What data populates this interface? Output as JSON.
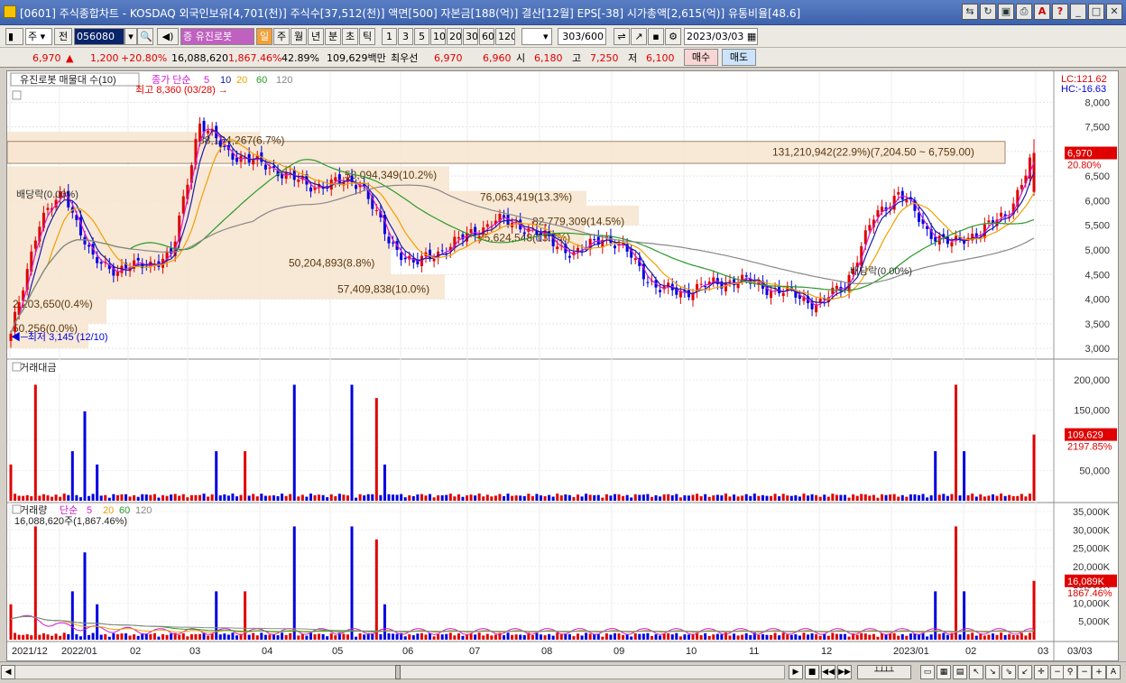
{
  "window": {
    "title": "[0601] 주식종합차트 - KOSDAQ 외국인보유[4,701(천)] 주식수[37,512(천)] 액면[500] 자본금[188(억)] 결산[12월] EPS[-38] 시가총액[2,615(억)] 유통비율[48.6]"
  },
  "toolbar": {
    "period_select": "주",
    "prev_label": "전",
    "stock_code": "056080",
    "stock_name": "유진로봇",
    "tabs": [
      "일",
      "주",
      "월",
      "년",
      "분",
      "초",
      "틱"
    ],
    "active_tab": "일",
    "intervals": [
      "1",
      "3",
      "5",
      "10",
      "20",
      "30",
      "60",
      "120"
    ],
    "count": "303",
    "count_total": "/600",
    "date": "2023/03/03"
  },
  "quote": {
    "price": "6,970",
    "arrow": "▲",
    "change": "1,200",
    "change_pct": "+20.80%",
    "volume": "16,088,620",
    "volume_pct": "1,867.46%",
    "ratio": "42.89%",
    "amount": "109,629백만",
    "best_label": "최우선",
    "best_ask": "6,970",
    "best_bid": "6,960",
    "open_label": "시",
    "open": "6,180",
    "high_label": "고",
    "high": "7,250",
    "low_label": "저",
    "low": "6,100",
    "buy_label": "매수",
    "sell_label": "매도"
  },
  "price_panel": {
    "legend_stock": "유진로봇 매물대 수(10)",
    "legend_ma": "종가 단순",
    "ma_periods": [
      "5",
      "10",
      "20",
      "60",
      "120"
    ],
    "high_label": "최고 8,360 (03/28)",
    "low_label": "최저 3,145 (12/10)",
    "lc": "LC:121.62",
    "hc": "HC:-16.63",
    "last_price": "6,970",
    "last_pct": "20.80%",
    "dividend_labels": [
      "배당락(0.00%)",
      "배당락(0.00%)"
    ],
    "volume_profile": [
      {
        "label": "38,164,267(6.7%)"
      },
      {
        "label": "131,210,942(22.9%)(7,204.50 ~ 6,759.00)"
      },
      {
        "label": "58,094,349(10.2%)"
      },
      {
        "label": "76,063,419(13.3%)"
      },
      {
        "label": "82,779,309(14.5%)"
      },
      {
        "label": "75,624,548(13.2%)"
      },
      {
        "label": "50,204,893(8.8%)"
      },
      {
        "label": "57,409,838(10.0%)"
      },
      {
        "label": "2,203,650(0.4%)"
      },
      {
        "label": "50,256(0.0%)"
      }
    ]
  },
  "amount_panel": {
    "legend": "거래대금",
    "last_value": "109,629",
    "last_pct": "2197.85%"
  },
  "volume_panel": {
    "legend": "거래량",
    "legend_ma": "단순",
    "ma_periods": [
      "5",
      "20",
      "60",
      "120"
    ],
    "current": "16,088,620주(1,867.46%)",
    "last_value": "16,089K",
    "last_pct": "1867.46%"
  },
  "colors": {
    "up": "#e00000",
    "down": "#0000e0",
    "ma5": "#d11bd1",
    "ma10": "#1a1aa8",
    "ma20": "#f0a000",
    "ma60": "#2a9a2a",
    "ma120": "#888888",
    "profile": "#f7e6d2"
  },
  "chart_data": [
    {
      "type": "candlestick",
      "title": "유진로봇",
      "x": [
        "2021/12",
        "2022/01",
        "02",
        "03",
        "04",
        "05",
        "06",
        "07",
        "08",
        "09",
        "10",
        "11",
        "12",
        "2023/01",
        "02",
        "03"
      ],
      "y_ticks": [
        3000,
        3500,
        4000,
        4500,
        5000,
        5500,
        6000,
        6500,
        7000,
        7500,
        8000
      ],
      "y_tick_labels": [
        "3,000",
        "3,500",
        "4,000",
        "4,500",
        "5,000",
        "5,500",
        "6,000",
        "6,500",
        "7,000",
        "7,500",
        "8,000"
      ],
      "ylim": [
        2800,
        8300
      ],
      "series_close": [
        3250,
        5500,
        6200,
        4800,
        4600,
        4700,
        4900,
        7600,
        7000,
        6800,
        6600,
        6300,
        6350,
        6400,
        5200,
        4700,
        5000,
        5300,
        5600,
        5500,
        5200,
        4900,
        5300,
        4900,
        4200,
        4150,
        4300,
        4400,
        4250,
        4100,
        3900,
        4300,
        5600,
        6200,
        5400,
        5100,
        5400,
        5700,
        6970
      ],
      "high": 8360,
      "low": 3145,
      "last": 6970
    },
    {
      "type": "bar",
      "title": "거래대금",
      "y_ticks": [
        50000,
        100000,
        150000,
        200000
      ],
      "y_tick_labels": [
        "50,000",
        "",
        "150,000",
        "200,000"
      ],
      "ylim": [
        0,
        230000
      ],
      "last": 109629
    },
    {
      "type": "bar",
      "title": "거래량",
      "y_ticks": [
        5000,
        10000,
        15000,
        20000,
        25000,
        30000,
        35000
      ],
      "y_tick_labels": [
        "5,000K",
        "10,000K",
        "15,000K",
        "20,000K",
        "25,000K",
        "30,000K",
        "35,000K"
      ],
      "ylim": [
        0,
        37000
      ],
      "last": 16089
    }
  ]
}
